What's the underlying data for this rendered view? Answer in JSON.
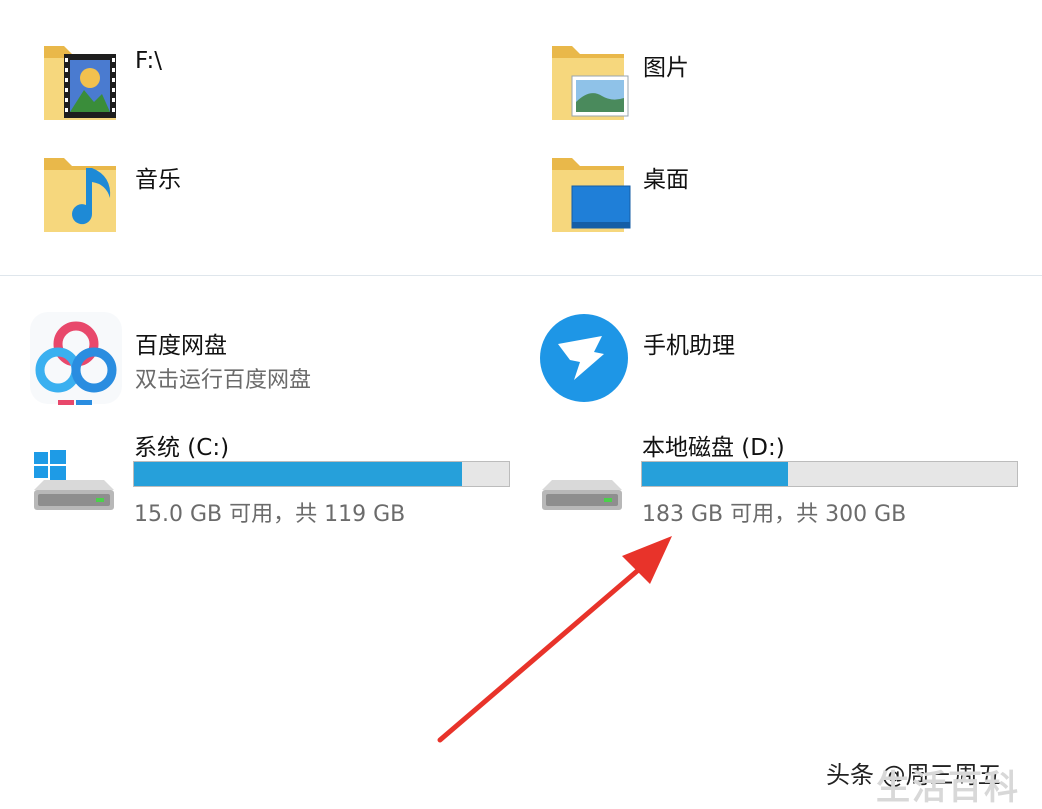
{
  "folders": [
    {
      "label": "F:\\",
      "icon": "video-folder-icon"
    },
    {
      "label": "图片",
      "icon": "pictures-folder-icon"
    },
    {
      "label": "音乐",
      "icon": "music-folder-icon"
    },
    {
      "label": "桌面",
      "icon": "desktop-folder-icon"
    }
  ],
  "apps": [
    {
      "label": "百度网盘",
      "sub": "双击运行百度网盘",
      "icon": "baidu-netdisk-icon"
    },
    {
      "label": "手机助理",
      "icon": "phone-assistant-icon"
    }
  ],
  "drives": [
    {
      "label": "系统 (C:)",
      "usage_text": "15.0 GB 可用，共 119 GB",
      "used_fraction": 0.874,
      "icon": "windows-drive-icon"
    },
    {
      "label": "本地磁盘 (D:)",
      "usage_text": "183 GB 可用，共 300 GB",
      "used_fraction": 0.39,
      "icon": "hard-drive-icon"
    }
  ],
  "annotation": {
    "type": "red-arrow",
    "color": "#e8332a"
  },
  "watermark": {
    "source": "头条 @周三周五",
    "brand": "生活百科"
  },
  "colors": {
    "bar_fill": "#26a0da",
    "bar_bg": "#e6e6e6"
  }
}
